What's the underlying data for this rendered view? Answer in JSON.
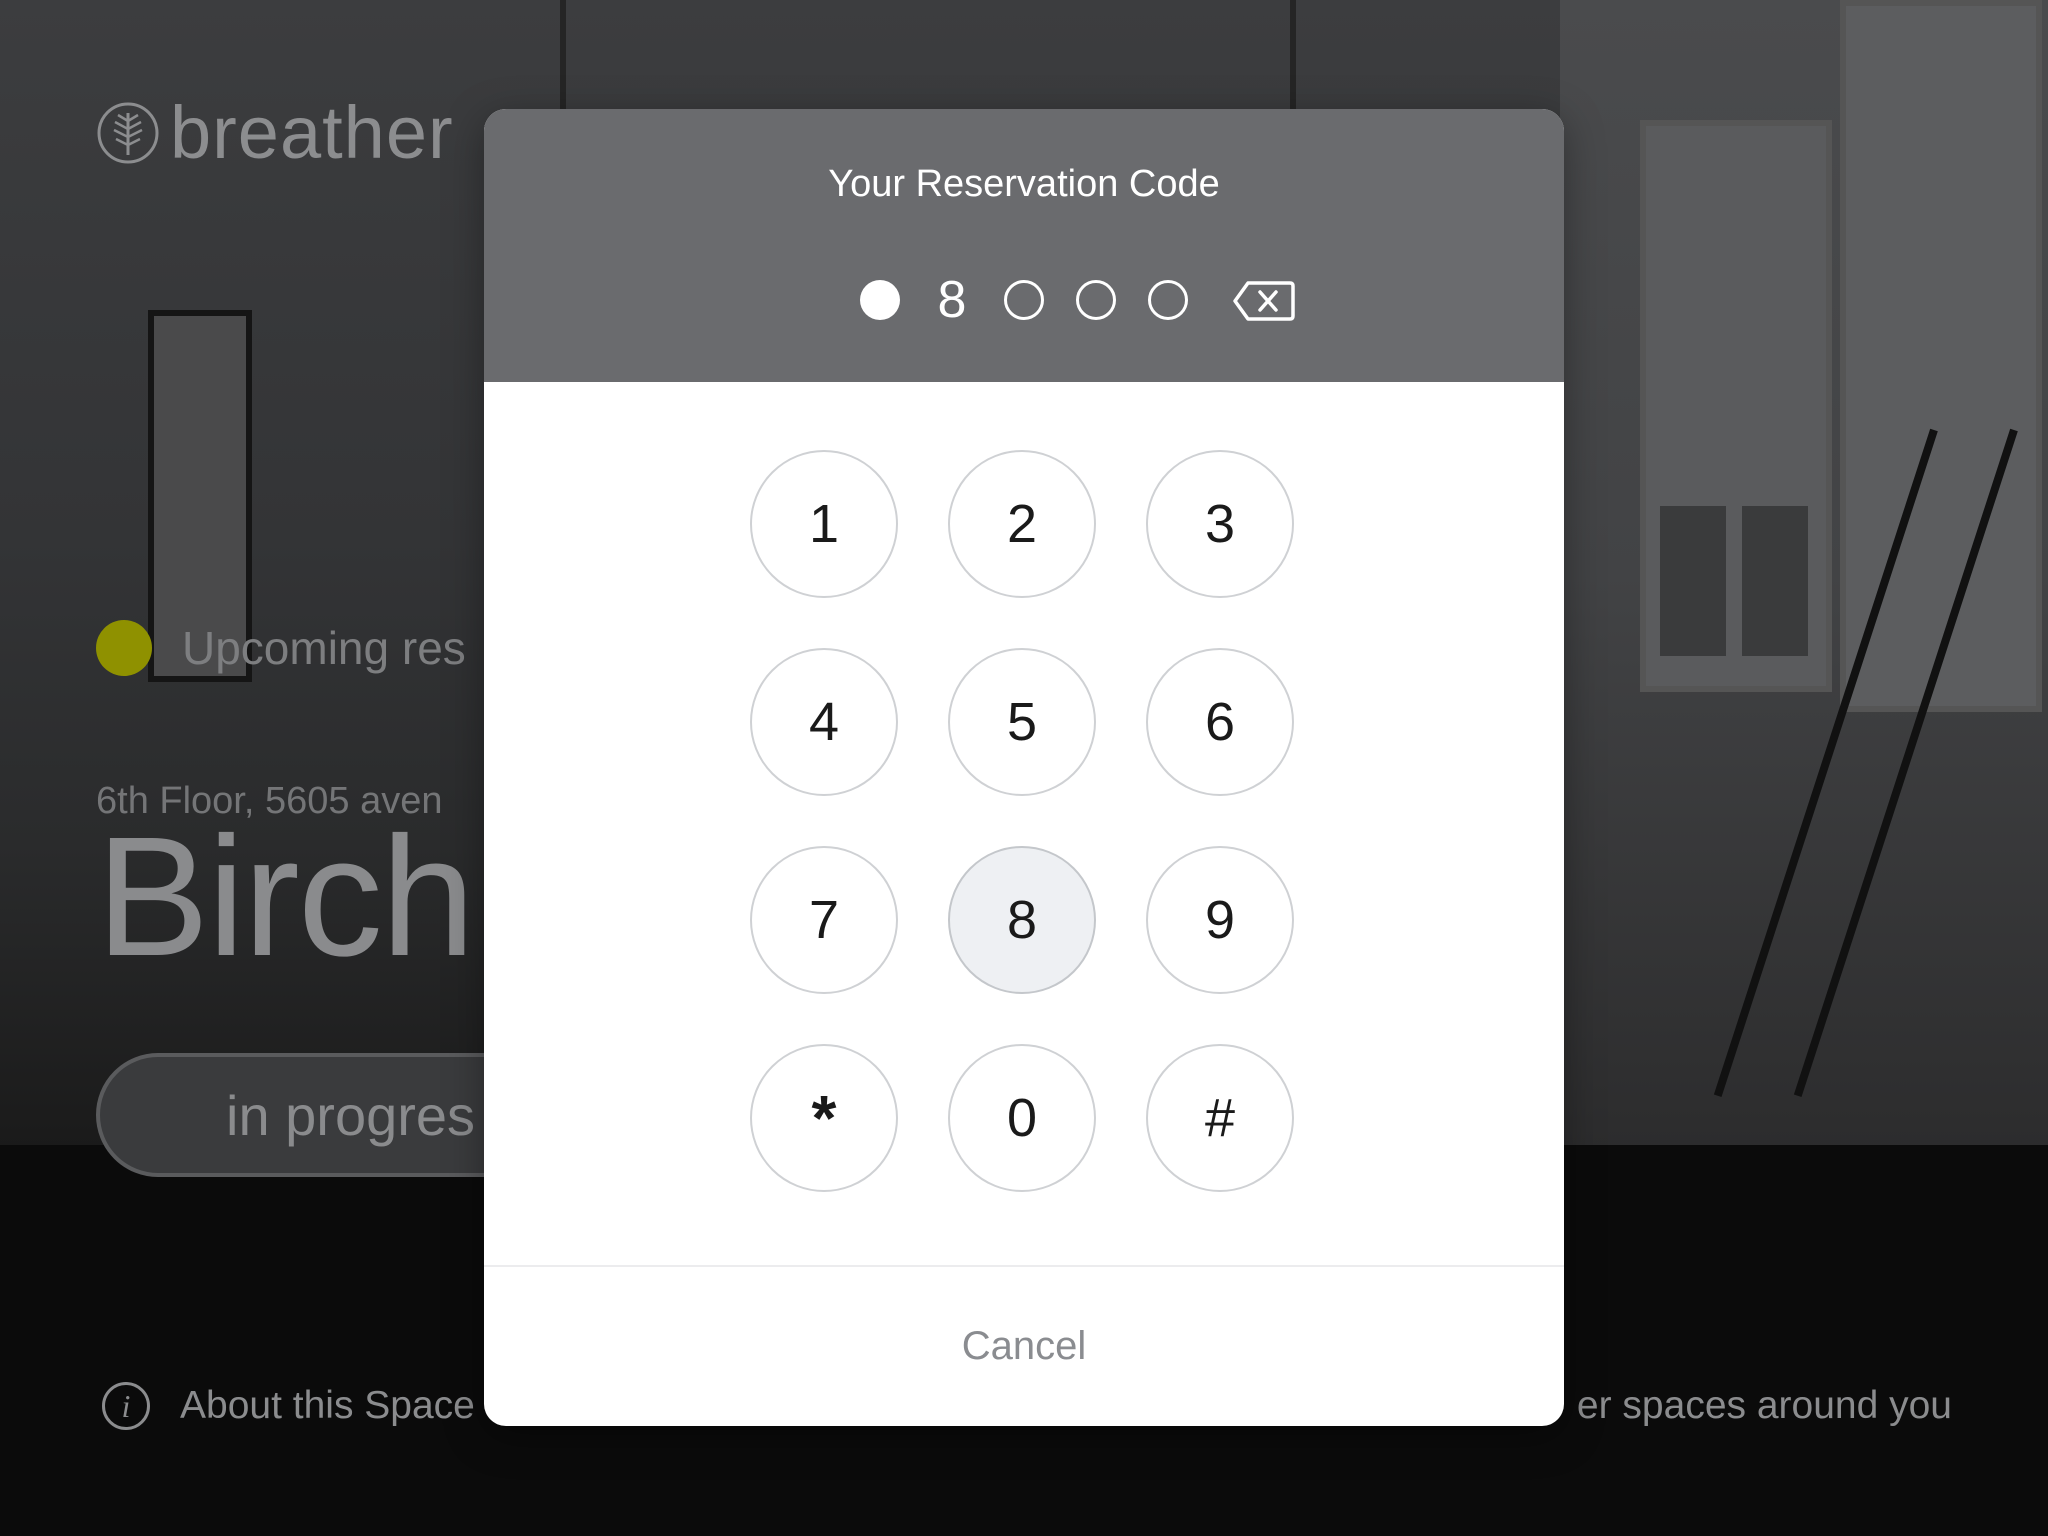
{
  "background": {
    "brand": {
      "name": "breather",
      "logo_icon": "tree-logo-icon"
    },
    "status": {
      "text": "Upcoming res",
      "dot_color": "#8f9100"
    },
    "address": "6th Floor, 5605 aven",
    "space_name": "Birch",
    "progress_label": "in progres",
    "about": {
      "icon": "info-icon",
      "label": "About this Space"
    },
    "explore_label": "er spaces around you"
  },
  "modal": {
    "title": "Your Reservation Code",
    "code": {
      "slots": [
        {
          "state": "filled"
        },
        {
          "state": "digit",
          "value": "8"
        },
        {
          "state": "empty"
        },
        {
          "state": "empty"
        },
        {
          "state": "empty"
        }
      ],
      "backspace_icon": "backspace-icon"
    },
    "keypad": {
      "keys": [
        "1",
        "2",
        "3",
        "4",
        "5",
        "6",
        "7",
        "8",
        "9",
        "*",
        "0",
        "#"
      ],
      "active_key": "8"
    },
    "cancel_label": "Cancel"
  },
  "colors": {
    "header_bg": "#6a6b6e",
    "key_border": "#cfd1d4",
    "active_key_bg": "#eef0f3",
    "cancel_text": "#8a8c90"
  }
}
